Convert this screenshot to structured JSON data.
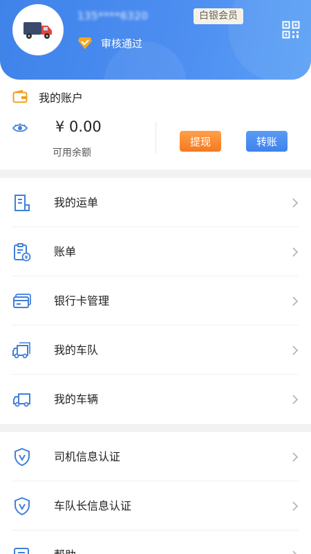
{
  "header": {
    "phone": "135****6320",
    "member_badge": "白银会员",
    "verify_status": "审核通过"
  },
  "account": {
    "title": "我的账户",
    "balance": "¥ 0.00",
    "balance_label": "可用余额",
    "withdraw_label": "提现",
    "transfer_label": "转账"
  },
  "menu": {
    "items": [
      {
        "label": "我的运单",
        "icon": "document-icon"
      },
      {
        "label": "账单",
        "icon": "bill-icon"
      },
      {
        "label": "银行卡管理",
        "icon": "bank-card-icon"
      },
      {
        "label": "我的车队",
        "icon": "fleet-truck-icon"
      },
      {
        "label": "我的车辆",
        "icon": "truck-icon"
      },
      {
        "label": "司机信息认证",
        "icon": "shield-icon"
      },
      {
        "label": "车队长信息认证",
        "icon": "shield-icon"
      },
      {
        "label": "帮助",
        "icon": "help-icon"
      }
    ]
  },
  "colors": {
    "header_blue": "#4c8df0",
    "icon_blue": "#3f7fd9",
    "withdraw_orange": "#f47a1f",
    "transfer_blue": "#3f82ec",
    "account_icon_orange": "#f0a020"
  }
}
